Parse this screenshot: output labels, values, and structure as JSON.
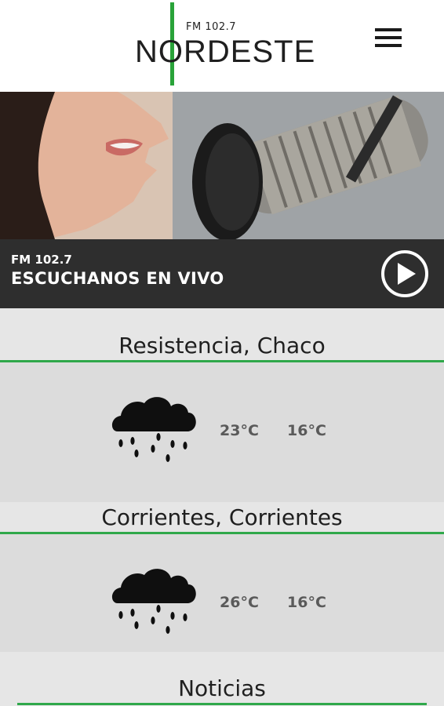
{
  "header": {
    "logo_frequency": "FM 102.7",
    "logo_name": "NORDESTE",
    "menu_icon": "hamburger-menu-icon",
    "accent_color": "#29a339"
  },
  "live": {
    "frequency": "FM 102.7",
    "title": "ESCUCHANOS EN VIVO",
    "play_icon": "play-icon"
  },
  "weather": [
    {
      "city": "Resistencia, Chaco",
      "icon": "rain-cloud-icon",
      "max_temp": "23°C",
      "min_temp": "16°C"
    },
    {
      "city": "Corrientes, Corrientes",
      "icon": "rain-cloud-icon",
      "max_temp": "26°C",
      "min_temp": "16°C"
    }
  ],
  "news": {
    "title": "Noticias"
  }
}
